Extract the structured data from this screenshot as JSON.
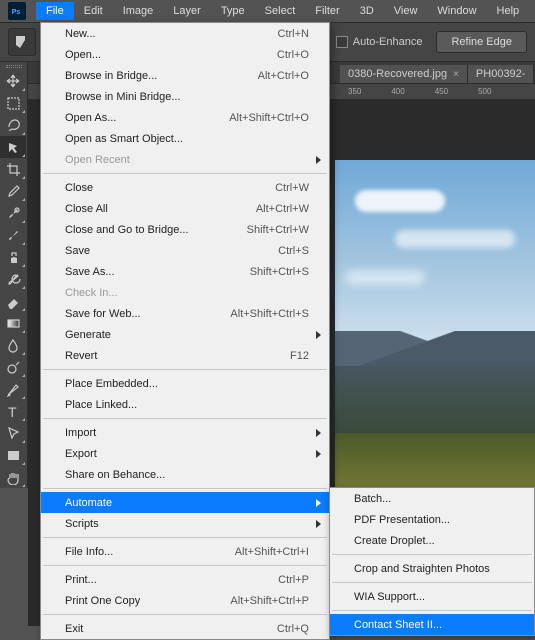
{
  "app_icon_letters": "Ps",
  "menubar": [
    "File",
    "Edit",
    "Image",
    "Layer",
    "Type",
    "Select",
    "Filter",
    "3D",
    "View",
    "Window",
    "Help"
  ],
  "menubar_active_index": 0,
  "options_bar": {
    "auto_enhance_label": "Auto-Enhance",
    "refine_edge_label": "Refine Edge"
  },
  "tabs": [
    {
      "name": "0380-Recovered.jpg",
      "close": "×"
    },
    {
      "name": "PH00392-",
      "close": ""
    }
  ],
  "ruler_ticks": [
    "350",
    "400",
    "450",
    "500"
  ],
  "file_menu": [
    {
      "type": "item",
      "label": "New...",
      "shortcut": "Ctrl+N"
    },
    {
      "type": "item",
      "label": "Open...",
      "shortcut": "Ctrl+O"
    },
    {
      "type": "item",
      "label": "Browse in Bridge...",
      "shortcut": "Alt+Ctrl+O"
    },
    {
      "type": "item",
      "label": "Browse in Mini Bridge..."
    },
    {
      "type": "item",
      "label": "Open As...",
      "shortcut": "Alt+Shift+Ctrl+O"
    },
    {
      "type": "item",
      "label": "Open as Smart Object..."
    },
    {
      "type": "item",
      "label": "Open Recent",
      "submenu": true,
      "disabled": true
    },
    {
      "type": "sep"
    },
    {
      "type": "item",
      "label": "Close",
      "shortcut": "Ctrl+W"
    },
    {
      "type": "item",
      "label": "Close All",
      "shortcut": "Alt+Ctrl+W"
    },
    {
      "type": "item",
      "label": "Close and Go to Bridge...",
      "shortcut": "Shift+Ctrl+W"
    },
    {
      "type": "item",
      "label": "Save",
      "shortcut": "Ctrl+S"
    },
    {
      "type": "item",
      "label": "Save As...",
      "shortcut": "Shift+Ctrl+S"
    },
    {
      "type": "item",
      "label": "Check In...",
      "disabled": true
    },
    {
      "type": "item",
      "label": "Save for Web...",
      "shortcut": "Alt+Shift+Ctrl+S"
    },
    {
      "type": "item",
      "label": "Generate",
      "submenu": true
    },
    {
      "type": "item",
      "label": "Revert",
      "shortcut": "F12"
    },
    {
      "type": "sep"
    },
    {
      "type": "item",
      "label": "Place Embedded..."
    },
    {
      "type": "item",
      "label": "Place Linked..."
    },
    {
      "type": "sep"
    },
    {
      "type": "item",
      "label": "Import",
      "submenu": true
    },
    {
      "type": "item",
      "label": "Export",
      "submenu": true
    },
    {
      "type": "item",
      "label": "Share on Behance..."
    },
    {
      "type": "sep"
    },
    {
      "type": "item",
      "label": "Automate",
      "submenu": true,
      "hover": true
    },
    {
      "type": "item",
      "label": "Scripts",
      "submenu": true
    },
    {
      "type": "sep"
    },
    {
      "type": "item",
      "label": "File Info...",
      "shortcut": "Alt+Shift+Ctrl+I"
    },
    {
      "type": "sep"
    },
    {
      "type": "item",
      "label": "Print...",
      "shortcut": "Ctrl+P"
    },
    {
      "type": "item",
      "label": "Print One Copy",
      "shortcut": "Alt+Shift+Ctrl+P"
    },
    {
      "type": "sep"
    },
    {
      "type": "item",
      "label": "Exit",
      "shortcut": "Ctrl+Q"
    }
  ],
  "automate_submenu": [
    {
      "type": "item",
      "label": "Batch..."
    },
    {
      "type": "item",
      "label": "PDF Presentation..."
    },
    {
      "type": "item",
      "label": "Create Droplet..."
    },
    {
      "type": "sep"
    },
    {
      "type": "item",
      "label": "Crop and Straighten Photos"
    },
    {
      "type": "sep"
    },
    {
      "type": "item",
      "label": "WIA Support..."
    },
    {
      "type": "sep"
    },
    {
      "type": "item",
      "label": "Contact Sheet II...",
      "hover": true
    }
  ],
  "tools": [
    "move",
    "marquee",
    "lasso",
    "quick-select",
    "crop",
    "eyedropper",
    "spot-heal",
    "brush",
    "clone",
    "history-brush",
    "eraser",
    "gradient",
    "blur",
    "dodge",
    "pen",
    "type",
    "path-select",
    "rectangle",
    "hand"
  ],
  "selected_tool_index": 3,
  "colors": {
    "highlight": "#0a7cff"
  }
}
